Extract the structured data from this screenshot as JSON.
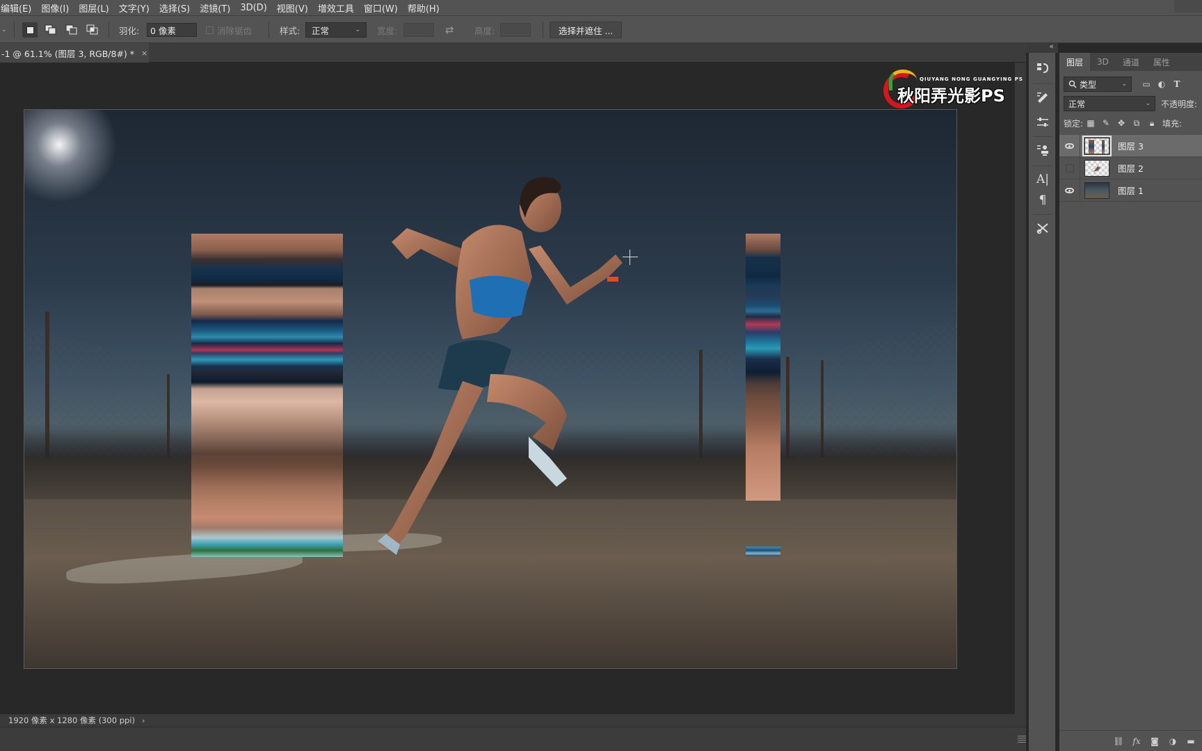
{
  "menu": [
    "编辑(E)",
    "图像(I)",
    "图层(L)",
    "文字(Y)",
    "选择(S)",
    "滤镜(T)",
    "3D(D)",
    "视图(V)",
    "增效工具",
    "窗口(W)",
    "帮助(H)"
  ],
  "options": {
    "feather_label": "羽化:",
    "feather_value": "0 像素",
    "antialias_label": "消除锯齿",
    "style_label": "样式:",
    "style_value": "正常",
    "width_label": "宽度:",
    "height_label": "高度:",
    "select_mask_button": "选择并遮住 ..."
  },
  "document_tab": {
    "title": "-1 @ 61.1% (图层 3, RGB/8#) *",
    "close": "×"
  },
  "watermark": {
    "small": "QIUYANG NONG GUANGYING PS",
    "big": "秋阳弄光影PS"
  },
  "status": {
    "text": "1920 像素 x 1280 像素 (300 ppi)",
    "arrow": "›"
  },
  "panel": {
    "tabs": [
      "图层",
      "3D",
      "通道",
      "属性"
    ],
    "active_tab": "图层",
    "filter_value": "类型",
    "blend_mode": "正常",
    "opacity_label": "不透明度:",
    "lock_label": "锁定:",
    "fill_label": "填充:",
    "layers": [
      {
        "name": "图层 3",
        "visible": true,
        "selected": true
      },
      {
        "name": "图层 2",
        "visible": false,
        "selected": false
      },
      {
        "name": "图层 1",
        "visible": true,
        "selected": false
      }
    ]
  },
  "tools": [
    "history-brush-icon",
    "brush-settings-icon",
    "adjustments-icon",
    "clone-source-icon",
    "character-icon",
    "paragraph-icon",
    "tool-presets-icon"
  ],
  "colors": {
    "ui_bg": "#535353",
    "workspace_bg": "#282828",
    "watermark_red": "#d4171e"
  }
}
